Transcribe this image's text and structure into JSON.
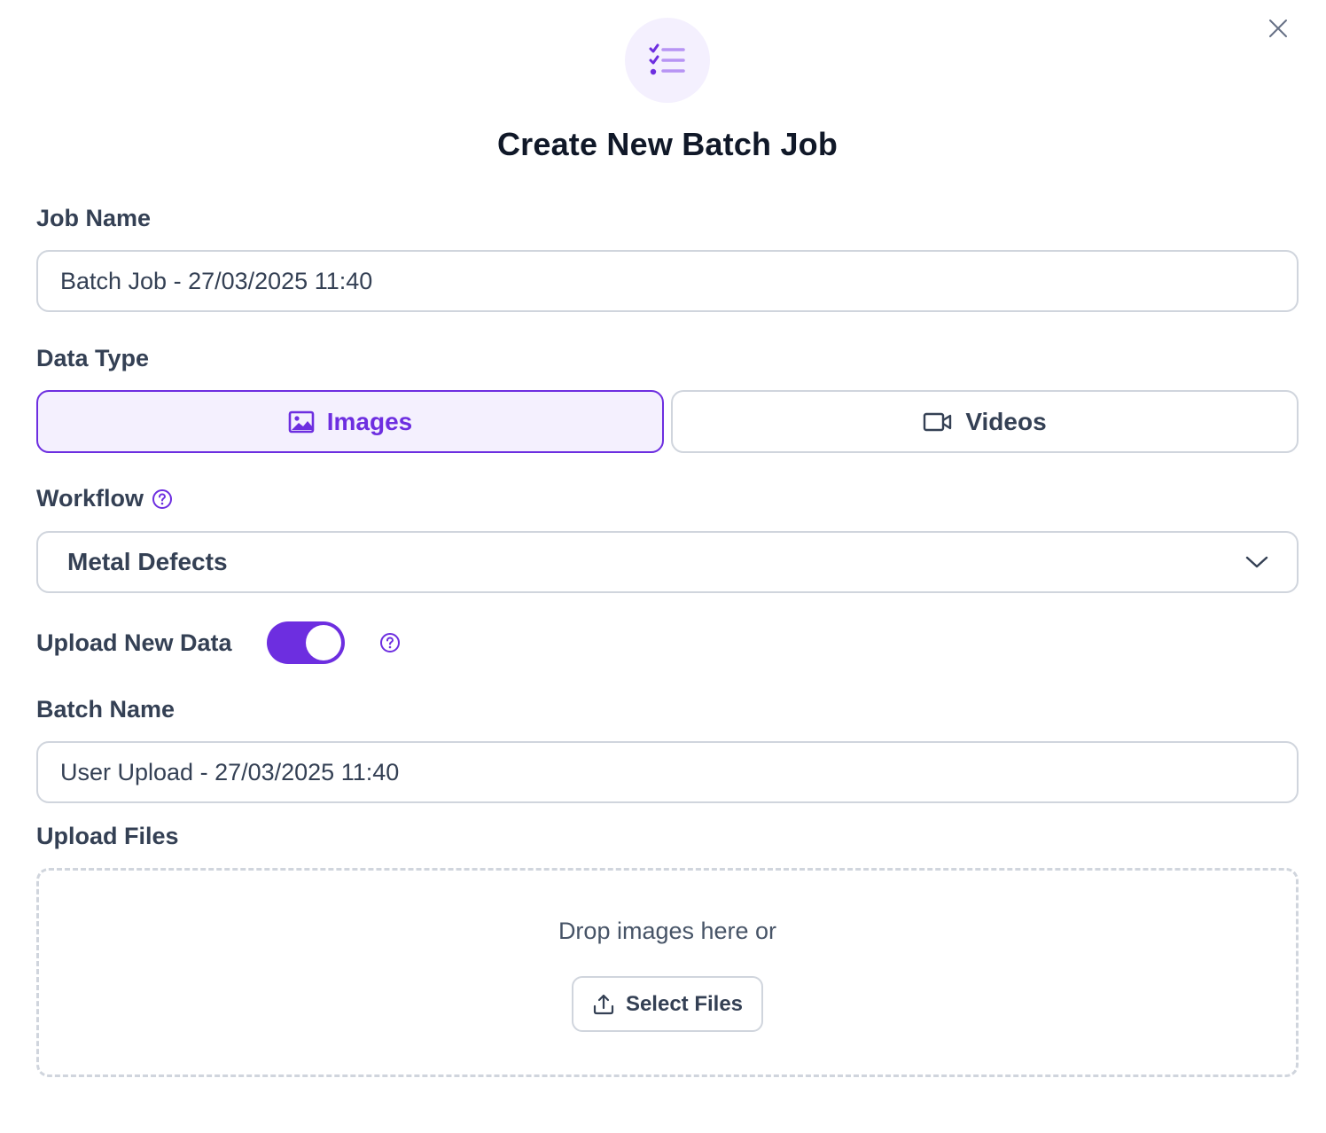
{
  "dialog": {
    "title": "Create New Batch Job",
    "header_icon": "checklist-icon",
    "close_icon": "close-icon"
  },
  "job_name": {
    "label": "Job Name",
    "value": "Batch Job - 27/03/2025 11:40"
  },
  "data_type": {
    "label": "Data Type",
    "options": [
      {
        "label": "Images",
        "icon": "image-icon",
        "selected": true
      },
      {
        "label": "Videos",
        "icon": "video-icon",
        "selected": false
      }
    ]
  },
  "workflow": {
    "label": "Workflow",
    "help_icon": "help-circle-icon",
    "selected": "Metal Defects",
    "chevron_icon": "chevron-down-icon"
  },
  "upload_new_data": {
    "label": "Upload New Data",
    "enabled": true,
    "help_icon": "help-circle-icon"
  },
  "batch_name": {
    "label": "Batch Name",
    "value": "User Upload - 27/03/2025 11:40"
  },
  "upload_files": {
    "label": "Upload Files",
    "drop_text": "Drop images here or",
    "button_label": "Select Files",
    "button_icon": "upload-icon"
  },
  "colors": {
    "accent": "#6d2ee0",
    "accent_bg": "#f4f0fe",
    "border": "#d0d5dd",
    "text": "#344054",
    "heading": "#101828"
  }
}
